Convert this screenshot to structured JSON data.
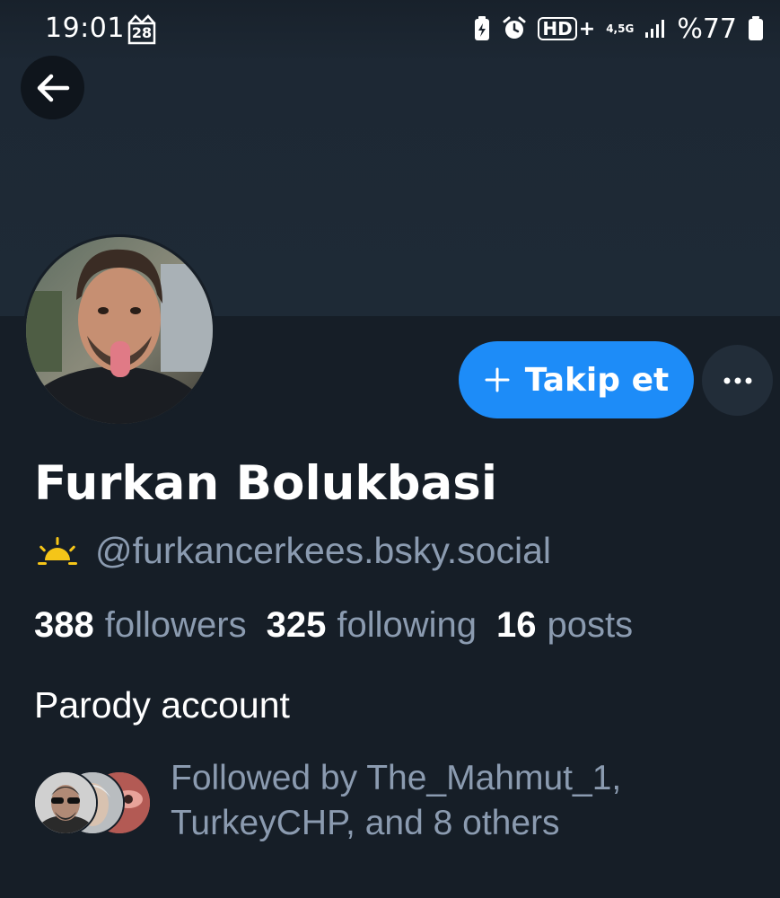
{
  "status_bar": {
    "time": "19:01",
    "calendar_day": "28",
    "network_label": "4,5G",
    "hd_label": "HD",
    "battery": "%77"
  },
  "profile": {
    "display_name": "Furkan Bolukbasi",
    "handle": "@furkancerkees.bsky.social",
    "bio": "Parody account",
    "follow_label": "Takip et"
  },
  "stats": {
    "followers_count": "388",
    "followers_label": "followers",
    "following_count": "325",
    "following_label": "following",
    "posts_count": "16",
    "posts_label": "posts"
  },
  "followed_by": {
    "text_line1": "Followed by The_Mahmut_1,",
    "text_line2": "TurkeyCHP, and 8 others"
  },
  "colors": {
    "accent": "#1d8cf8",
    "background": "#161e27",
    "banner": "#1e2a36",
    "muted_text": "#8b9bb0"
  },
  "icons": {
    "back": "arrow-left-icon",
    "plus": "plus-icon",
    "more": "ellipsis-icon",
    "sunrise": "sunrise-icon"
  }
}
